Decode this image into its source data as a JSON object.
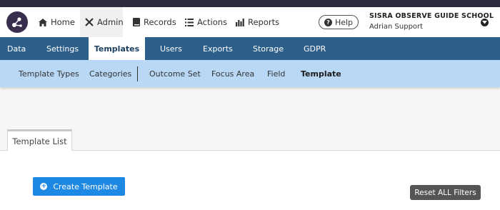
{
  "topnav": {
    "items": [
      {
        "label": "Home",
        "icon": "home-icon"
      },
      {
        "label": "Admin",
        "icon": "tools-icon"
      },
      {
        "label": "Records",
        "icon": "book-icon"
      },
      {
        "label": "Actions",
        "icon": "list-icon"
      },
      {
        "label": "Reports",
        "icon": "chart-icon"
      }
    ],
    "active": "Admin",
    "help_label": "Help"
  },
  "account": {
    "school": "SISRA OBSERVE GUIDE SCHOOL",
    "user": "Adrian Support"
  },
  "mainnav": {
    "items": [
      "Data",
      "Settings",
      "Templates",
      "Users",
      "Exports",
      "Storage",
      "GDPR"
    ],
    "active": "Templates"
  },
  "subnav": {
    "items": [
      "Template Types",
      "Categories",
      "Outcome Set",
      "Focus Area",
      "Field",
      "Template"
    ],
    "active": "Template"
  },
  "tab": {
    "label": "Template List"
  },
  "actions": {
    "create_label": "Create Template",
    "reset_label": "Reset ALL Filters"
  },
  "colors": {
    "main_nav_bg": "#2d5f8a",
    "sub_nav_bg": "#b8d8f5",
    "primary_button": "#1e88e5",
    "secondary_button": "#555555"
  }
}
